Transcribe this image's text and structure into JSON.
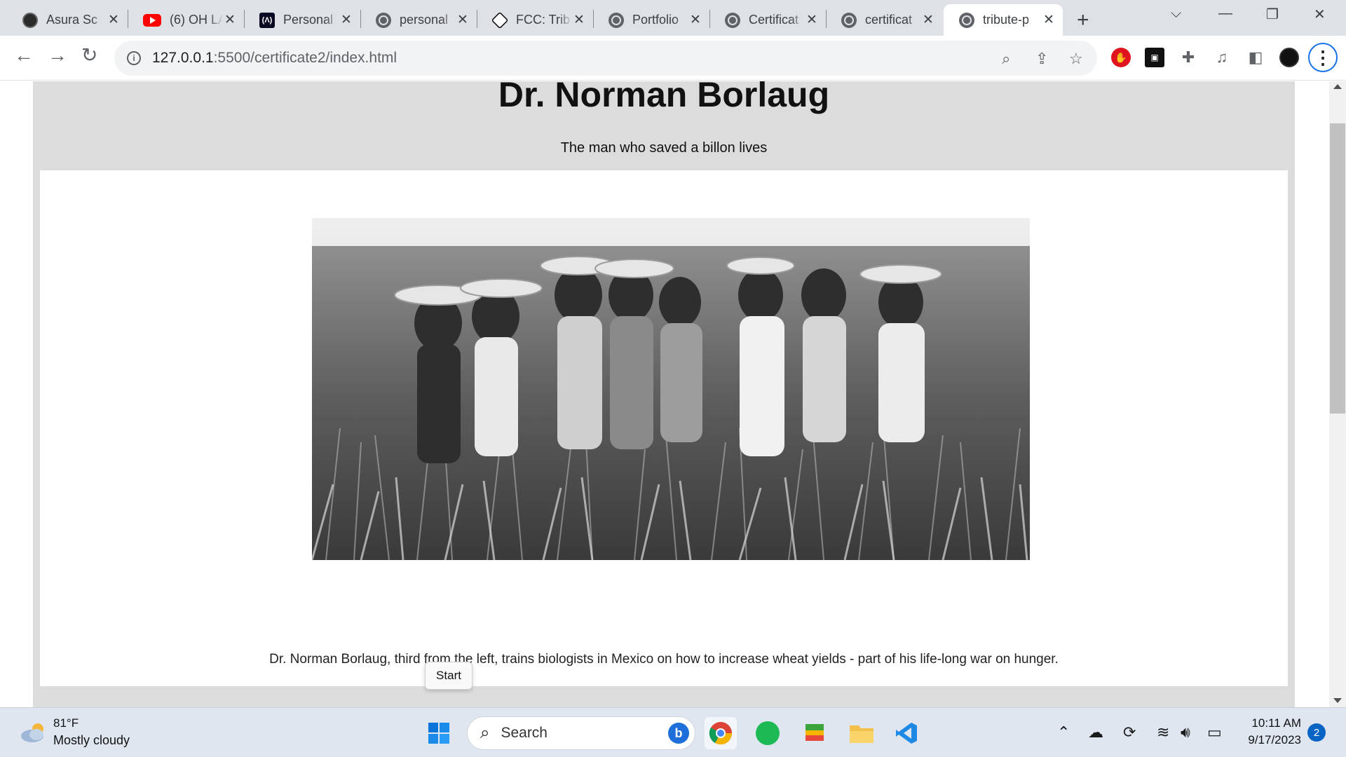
{
  "browser": {
    "tabs": [
      {
        "title": "Asura Sc",
        "icon": "asura-icon"
      },
      {
        "title": "(6) OH LA",
        "icon": "youtube-icon"
      },
      {
        "title": "Personal",
        "icon": "freecodecamp-icon"
      },
      {
        "title": "personal",
        "icon": "globe-icon"
      },
      {
        "title": "FCC: Trib",
        "icon": "codepen-icon"
      },
      {
        "title": "Portfolio",
        "icon": "globe-icon"
      },
      {
        "title": "Certificat",
        "icon": "globe-icon"
      },
      {
        "title": "certificat",
        "icon": "globe-icon"
      },
      {
        "title": "tribute-p",
        "icon": "globe-icon",
        "active": true
      }
    ],
    "url_host": "127.0.0.1",
    "url_path": ":5500/certificate2/index.html",
    "accent": "#1a73e8"
  },
  "page": {
    "title": "Dr. Norman Borlaug",
    "tagline": "The man who saved a billon lives",
    "caption": "Dr. Norman Borlaug, third from the left, trains biologists in Mexico on how to increase wheat yields - part of his life-long war on hunger.",
    "background": "#dcdcdd"
  },
  "tooltip": {
    "label": "Start"
  },
  "taskbar": {
    "weather_temp": "81°F",
    "weather_desc": "Mostly cloudy",
    "search_placeholder": "Search",
    "time": "10:11 AM",
    "date": "9/17/2023",
    "notification_count": "2"
  }
}
